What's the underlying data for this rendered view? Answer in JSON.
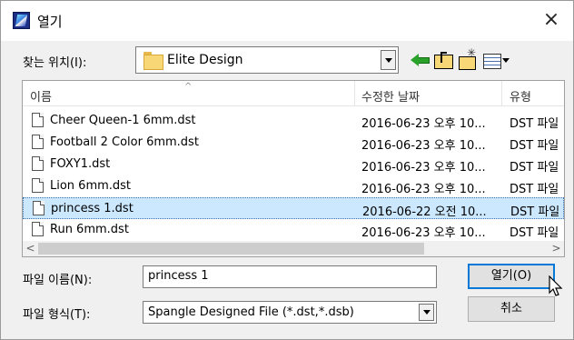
{
  "window": {
    "title": "열기",
    "close_label": "×"
  },
  "toolbar": {
    "look_in_label": "찾는 위치(I):",
    "look_in_value": "Elite Design"
  },
  "file_list": {
    "columns": [
      "이름",
      "수정한 날짜",
      "유형"
    ],
    "files": [
      {
        "name": "Cheer Queen-1 6mm.dst",
        "date": "2016-06-23 오후 10...",
        "type": "DST 파일",
        "selected": false
      },
      {
        "name": "Football 2 Color 6mm.dst",
        "date": "2016-06-23 오후 10...",
        "type": "DST 파일",
        "selected": false
      },
      {
        "name": "FOXY1.dst",
        "date": "2016-06-23 오후 10...",
        "type": "DST 파일",
        "selected": false
      },
      {
        "name": "Lion 6mm.dst",
        "date": "2016-06-23 오후 10...",
        "type": "DST 파일",
        "selected": false
      },
      {
        "name": "princess 1.dst",
        "date": "2016-06-22 오전 10...",
        "type": "DST 파일",
        "selected": true
      },
      {
        "name": "Run 6mm.dst",
        "date": "2016-06-23 오후 10...",
        "type": "DST 파일",
        "selected": false
      }
    ],
    "scroll_left": "<",
    "scroll_right": ">"
  },
  "footer": {
    "file_name_label": "파일 이름(N):",
    "file_name_value": "princess 1",
    "file_type_label": "파일 형식(T):",
    "file_type_value": "Spangle Designed File (*.dst,*.dsb)",
    "open_button": "열기(O)",
    "cancel_button": "취소"
  },
  "colors": {
    "accent": "#0078d7",
    "selection": "#cce8ff"
  }
}
